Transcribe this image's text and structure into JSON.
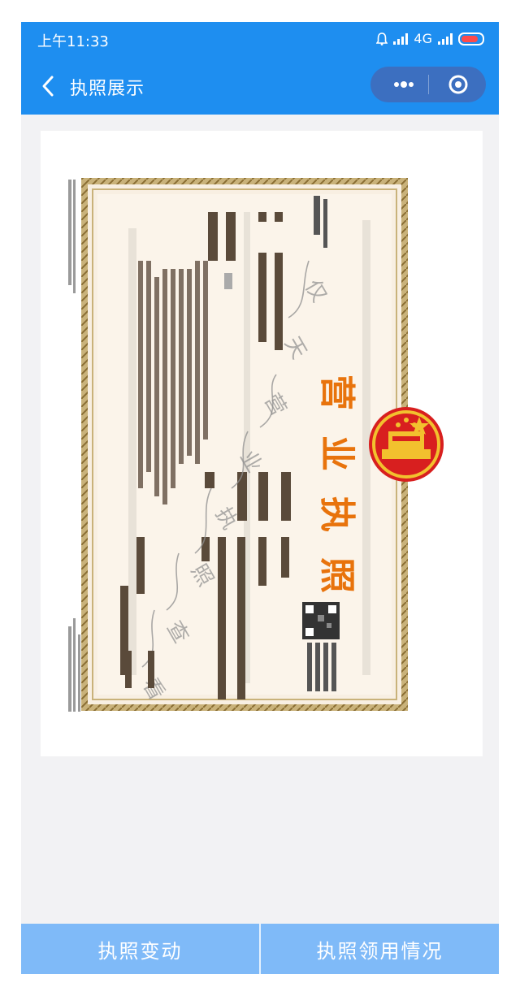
{
  "status_bar": {
    "time": "上午11:33",
    "network": "4G"
  },
  "nav": {
    "title": "执照展示"
  },
  "license": {
    "title_chars": [
      "营",
      "业",
      "执",
      "照"
    ],
    "watermark_chars": [
      "仅",
      "天",
      "营",
      "业",
      "执",
      "照",
      "查",
      "看"
    ]
  },
  "footer": {
    "change_label": "执照变动",
    "receive_label": "执照领用情况"
  },
  "colors": {
    "primary": "#1e8ef0",
    "capsule": "#3c6fc0",
    "footer": "#7fbaf8",
    "title_orange": "#e8730c",
    "seal_red": "#e02525",
    "border_gold": "#b59a5a"
  }
}
